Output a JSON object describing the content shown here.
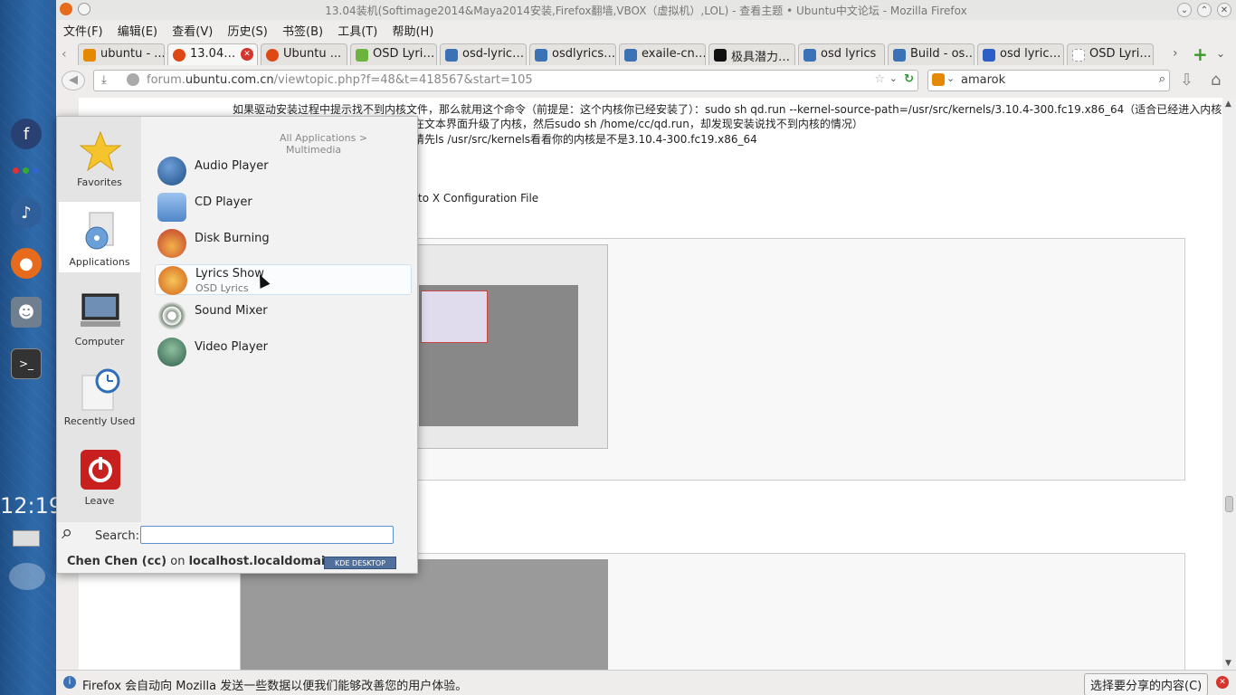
{
  "window": {
    "title": "13.04装机(Softimage2014&Maya2014安装,Firefox翻墙,VBOX（虚拟机）,LOL) - 查看主题 • Ubuntu中文论坛 - Mozilla Firefox"
  },
  "menubar": [
    "文件(F)",
    "编辑(E)",
    "查看(V)",
    "历史(S)",
    "书签(B)",
    "工具(T)",
    "帮助(H)"
  ],
  "tabs": [
    {
      "label": "ubuntu - ...",
      "color": "#e58a00"
    },
    {
      "label": "13.04…",
      "color": "#dd4814",
      "active": true
    },
    {
      "label": "Ubuntu ...",
      "color": "#dd4814"
    },
    {
      "label": "OSD Lyri…",
      "color": "#6cb33f"
    },
    {
      "label": "osd-lyric…",
      "color": "#3b72b5"
    },
    {
      "label": "osdlyrics…",
      "color": "#3b72b5"
    },
    {
      "label": "exaile-cn…",
      "color": "#3b72b5"
    },
    {
      "label": "极具潜力…",
      "color": "#111111"
    },
    {
      "label": "osd lyrics",
      "color": "#3b72b5"
    },
    {
      "label": "Build - os…",
      "color": "#3b72b5"
    },
    {
      "label": "osd lyric…",
      "color": "#2b5fc6"
    },
    {
      "label": "OSD Lyri…",
      "color": "#aaaaaa"
    }
  ],
  "navbar": {
    "url_prefix": "forum.",
    "url_domain": "ubuntu.com.cn",
    "url_path": "/viewtopic.php?f=48&t=418567&start=105",
    "search_value": "amarok"
  },
  "page": {
    "line1": "如果驱动安装过程中提示找不到内核文件，那么就用这个命令（前提是：这个内核你已经安装了）：sudo sh qd.run --kernel-source-path=/usr/src/kernels/3.10.4-300.fc19.x86_64（适合已经进入内核",
    "line2": "在文本界面升级了内核，然后sudo sh /home/cc/qd.run，却发现安装说找不到内核的情况）",
    "line3": "请先ls /usr/src/kernels看看你的内核是不是3.10.4-300.fc19.x86_64",
    "line4": "to X Configuration File"
  },
  "notification": {
    "text": "Firefox 会自动向 Mozilla 发送一些数据以便我们能够改善您的用户体验。",
    "button": "选择要分享的内容(C)"
  },
  "panel": {
    "clock": "12:19"
  },
  "launcher": {
    "sidebar": [
      {
        "label": "Favorites",
        "icon": "star-icon"
      },
      {
        "label": "Applications",
        "icon": "applications-icon",
        "active": true
      },
      {
        "label": "Computer",
        "icon": "computer-icon"
      },
      {
        "label": "Recently Used",
        "icon": "clock-icon"
      },
      {
        "label": "Leave",
        "icon": "power-icon"
      }
    ],
    "breadcrumb_root": "All Applications",
    "breadcrumb_sep": ">",
    "breadcrumb_current": "Multimedia",
    "apps": [
      {
        "name": "Audio Player",
        "sub": "",
        "color": "#2f5f9a"
      },
      {
        "name": "CD Player",
        "sub": "",
        "color": "#5b8fd0"
      },
      {
        "name": "Disk Burning",
        "sub": "",
        "color": "#c0392b"
      },
      {
        "name": "Lyrics Show",
        "sub": "OSD Lyrics",
        "color": "#e07b1f"
      },
      {
        "name": "Sound Mixer",
        "sub": "",
        "color": "#7a8a7a"
      },
      {
        "name": "Video Player",
        "sub": "",
        "color": "#4a7a5a"
      }
    ],
    "search_label": "Search:",
    "search_value": "",
    "user_name": "Chen Chen (cc)",
    "user_on": "on",
    "host": "localhost.localdomain",
    "badge": "KDE DESKTOP"
  }
}
